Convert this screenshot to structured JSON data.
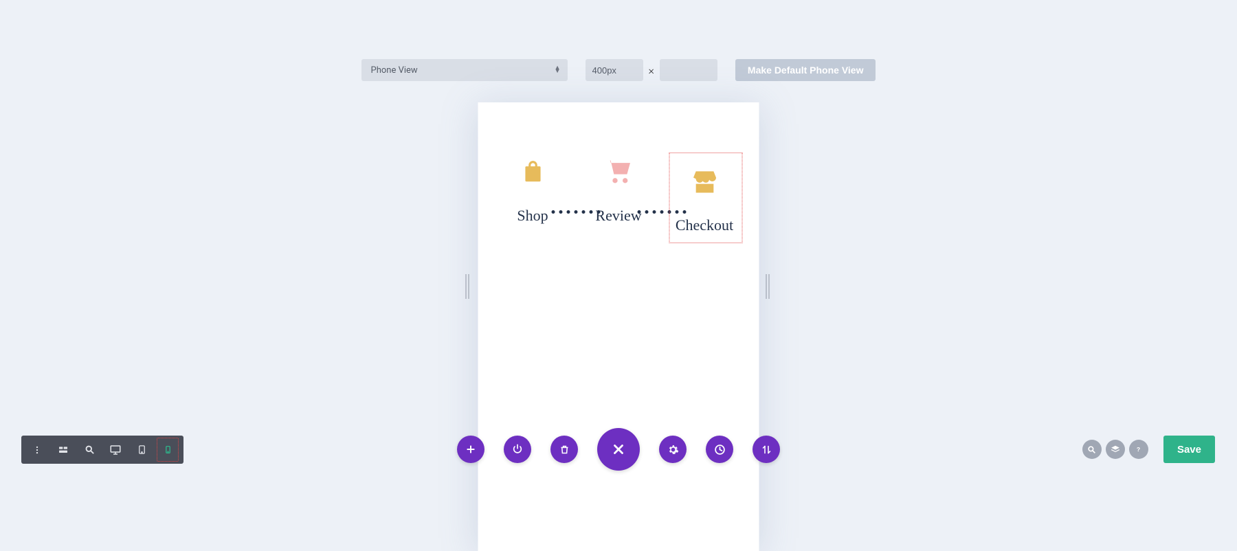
{
  "topbar": {
    "view_select": "Phone View",
    "width_value": "400px",
    "height_value": "",
    "default_button": "Make Default Phone View"
  },
  "steps": [
    {
      "label": "Shop",
      "icon": "shopping-bag"
    },
    {
      "label": "Review",
      "icon": "shopping-cart"
    },
    {
      "label": "Checkout",
      "icon": "storefront"
    }
  ],
  "colors": {
    "accent_purple": "#6d2fc1",
    "accent_teal": "#2fb38a",
    "icon_inactive": "#f3b0b0",
    "icon_gold": "#e7bb5b",
    "text_navy": "#24324a"
  },
  "bottom_toolbar": {
    "items": [
      {
        "name": "more",
        "active": false
      },
      {
        "name": "wireframe",
        "active": false
      },
      {
        "name": "zoom",
        "active": false
      },
      {
        "name": "desktop",
        "active": false
      },
      {
        "name": "tablet",
        "active": false
      },
      {
        "name": "phone",
        "active": true
      }
    ]
  },
  "action_bar": {
    "items": [
      "add",
      "power",
      "delete",
      "close",
      "settings",
      "history",
      "swap"
    ]
  },
  "bottom_right": {
    "items": [
      "search",
      "layers",
      "help"
    ],
    "save_label": "Save"
  }
}
